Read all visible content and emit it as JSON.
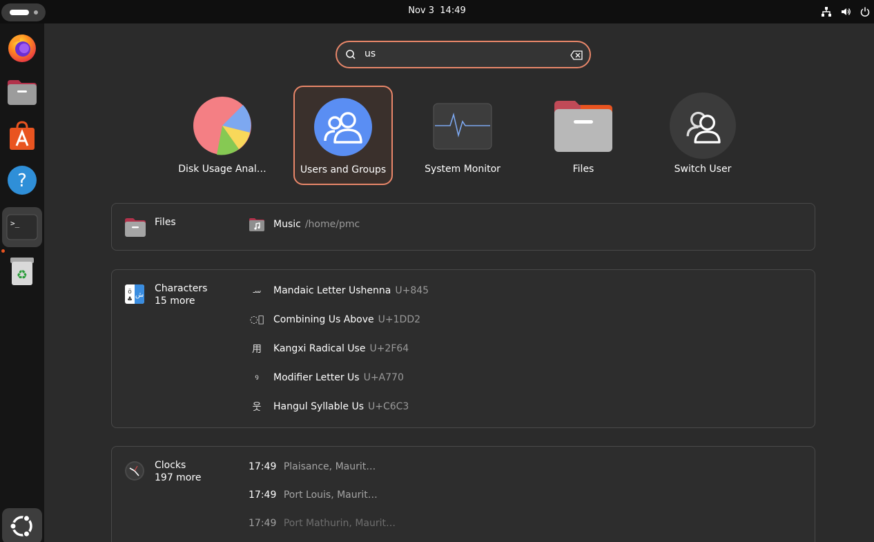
{
  "topbar": {
    "clock": "Nov 3  14:49"
  },
  "search": {
    "value": "us"
  },
  "apps": [
    {
      "label": "Disk Usage Anal…",
      "icon": "disk-usage-analyzer-icon",
      "selected": false
    },
    {
      "label": "Users and Groups",
      "icon": "users-and-groups-icon",
      "selected": true
    },
    {
      "label": "System Monitor",
      "icon": "system-monitor-icon",
      "selected": false
    },
    {
      "label": "Files",
      "icon": "files-icon",
      "selected": false
    },
    {
      "label": "Switch User",
      "icon": "switch-user-icon",
      "selected": false
    }
  ],
  "files_panel": {
    "title": "Files",
    "result": {
      "name": "Music",
      "path": "/home/pmc"
    }
  },
  "characters_panel": {
    "title": "Characters",
    "more": "15 more",
    "results": [
      {
        "glyph": "ࡄ",
        "name": "Mandaic Letter Ushenna",
        "code": "U+845"
      },
      {
        "glyph": "◌᷒",
        "name": "Combining Us Above",
        "code": "U+1DD2"
      },
      {
        "glyph": "⽤",
        "name": "Kangxi Radical Use",
        "code": "U+2F64"
      },
      {
        "glyph": "ꝰ",
        "name": "Modifier Letter Us",
        "code": "U+A770"
      },
      {
        "glyph": "웃",
        "name": "Hangul Syllable Us",
        "code": "U+C6C3"
      }
    ]
  },
  "clocks_panel": {
    "title": "Clocks",
    "more": "197 more",
    "results": [
      {
        "time": "17:49",
        "location": "Plaisance, Maurit…"
      },
      {
        "time": "17:49",
        "location": "Port Louis, Maurit…"
      },
      {
        "time": "17:49",
        "location": "Port Mathurin, Maurit…"
      }
    ]
  },
  "colors": {
    "accent": "#e9876a",
    "ubuntu_orange": "#e95420"
  }
}
